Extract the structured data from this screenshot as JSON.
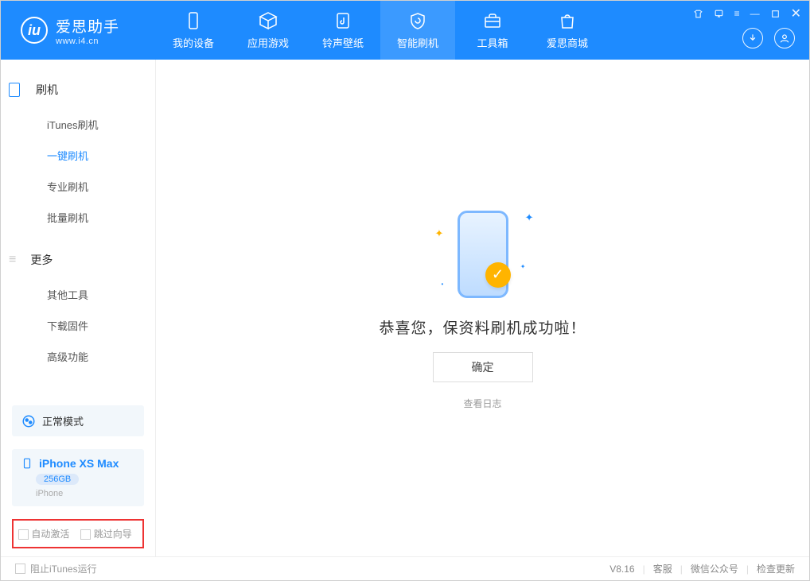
{
  "brand": {
    "name": "爱思助手",
    "url": "www.i4.cn"
  },
  "tabs": {
    "device": "我的设备",
    "apps": "应用游戏",
    "ringtone": "铃声壁纸",
    "flash": "智能刷机",
    "tools": "工具箱",
    "store": "爱思商城"
  },
  "sidebar": {
    "group_flash": "刷机",
    "group_more": "更多",
    "items": {
      "itunes": "iTunes刷机",
      "onekey": "一键刷机",
      "pro": "专业刷机",
      "batch": "批量刷机",
      "other": "其他工具",
      "fw": "下载固件",
      "adv": "高级功能"
    },
    "mode": "正常模式",
    "device": {
      "name": "iPhone XS Max",
      "storage": "256GB",
      "type": "iPhone"
    },
    "opts": {
      "auto_act": "自动激活",
      "skip_guide": "跳过向导"
    }
  },
  "main": {
    "success": "恭喜您，保资料刷机成功啦！",
    "ok": "确定",
    "view_log": "查看日志"
  },
  "footer": {
    "block_itunes": "阻止iTunes运行",
    "version": "V8.16",
    "service": "客服",
    "wechat": "微信公众号",
    "update": "检查更新"
  }
}
